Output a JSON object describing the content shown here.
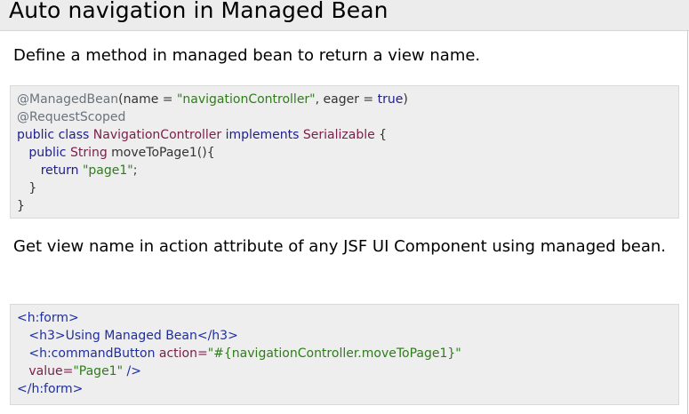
{
  "page": {
    "heading": "Auto navigation in Managed Bean",
    "intro": "Define a method in managed bean to return a view name.",
    "second_para": "Get view name in action attribute of any JSF UI Component using managed bean."
  },
  "code1": {
    "l1_ann": "@ManagedBean",
    "l1_p1": "(name = ",
    "l1_s1": "\"navigationController\"",
    "l1_p2": ", eager = ",
    "l1_kw": "true",
    "l1_p3": ")",
    "l2_ann": "@RequestScoped",
    "l3_kw1": "public class ",
    "l3_ty1": "NavigationController ",
    "l3_kw2": "implements ",
    "l3_ty2": "Serializable ",
    "l3_p": "{",
    "l4_ind": "   ",
    "l4_kw": "public ",
    "l4_ty": "String ",
    "l4_p": "moveToPage1(){",
    "l5_ind": "      ",
    "l5_kw": "return ",
    "l5_s": "\"page1\"",
    "l5_p": ";",
    "l6": "   }",
    "l7": "}"
  },
  "code2": {
    "l1": "<h:form>",
    "l2_ind": "   ",
    "l2": "<h3>Using Managed Bean</h3>",
    "l3_ind": "   ",
    "l3_tag": "<h:commandButton ",
    "l3_att": "action=",
    "l3_val": "\"#{navigationController.moveToPage1}\"",
    "l4_ind": "   ",
    "l4_att": "value=",
    "l4_val": "\"Page1\"",
    "l4_end": " />",
    "l5": "</h:form>"
  }
}
